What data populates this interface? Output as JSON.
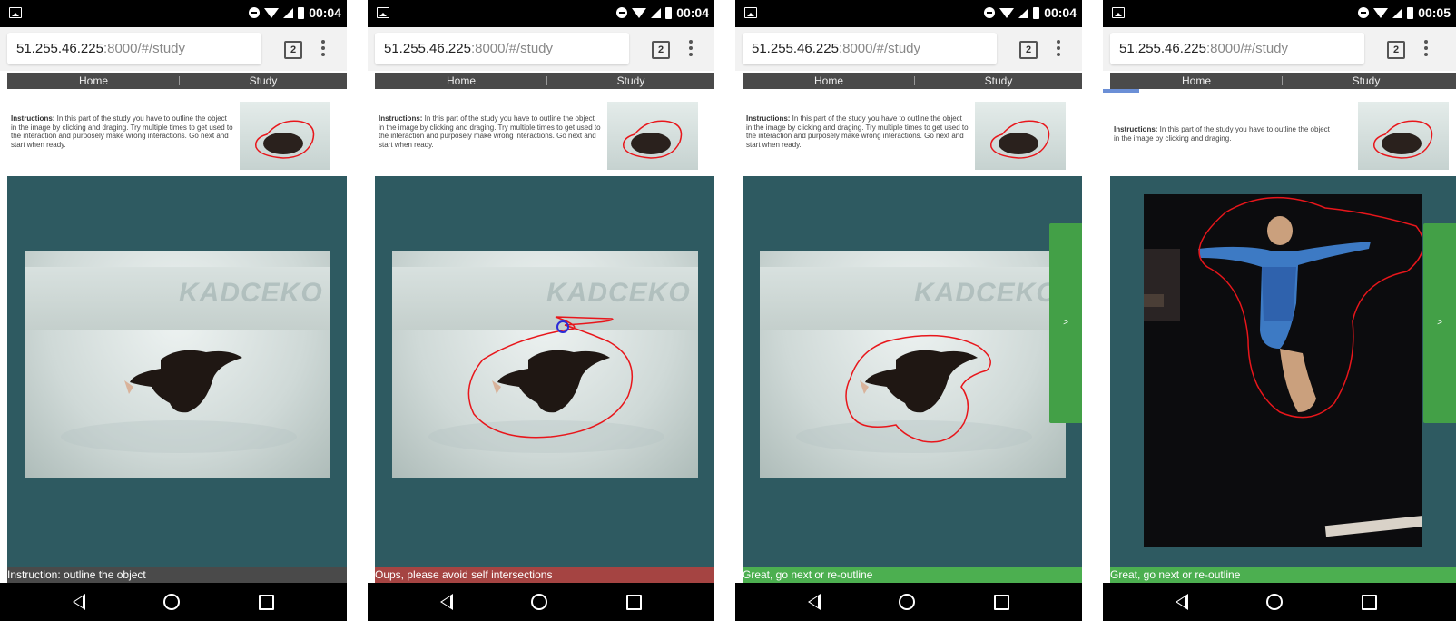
{
  "phones": [
    {
      "status_time": "00:04",
      "url_host": "51.255.46.225",
      "url_path": ":8000/#/study",
      "tab_count": "2",
      "nav": {
        "home": "Home",
        "study": "Study"
      },
      "instructions_label": "Instructions:",
      "instructions_text": " In this part of the study you have to outline the object in the image by clicking and draging. Try multiple times to get used to the interaction and purposely make wrong interactions. Go next and start when ready.",
      "message": "Instruction: outline the object",
      "message_status": "info",
      "photo_brand": "KADCEKO",
      "next_label": ""
    },
    {
      "status_time": "00:04",
      "url_host": "51.255.46.225",
      "url_path": ":8000/#/study",
      "tab_count": "2",
      "nav": {
        "home": "Home",
        "study": "Study"
      },
      "instructions_label": "Instructions:",
      "instructions_text": " In this part of the study you have to outline the object in the image by clicking and draging. Try multiple times to get used to the interaction and purposely make wrong interactions. Go next and start when ready.",
      "message": "Oups, please avoid self intersections",
      "message_status": "error",
      "photo_brand": "KADCEKO",
      "next_label": ""
    },
    {
      "status_time": "00:04",
      "url_host": "51.255.46.225",
      "url_path": ":8000/#/study",
      "tab_count": "2",
      "nav": {
        "home": "Home",
        "study": "Study"
      },
      "instructions_label": "Instructions:",
      "instructions_text": " In this part of the study you have to outline the object in the image by clicking and draging. Try multiple times to get used to the interaction and purposely make wrong interactions. Go next and start when ready.",
      "message": "Great, go next or re-outline",
      "message_status": "success",
      "photo_brand": "KADCEKO",
      "next_label": ">"
    },
    {
      "status_time": "00:05",
      "url_host": "51.255.46.225",
      "url_path": ":8000/#/study",
      "tab_count": "2",
      "nav": {
        "home": "Home",
        "study": "Study"
      },
      "instructions_label": "Instructions:",
      "instructions_text": " In this part of the study you have to outline the object in the image by clicking and draging.",
      "message": "Great, go next or re-outline",
      "message_status": "success",
      "photo_brand": "",
      "next_label": ">"
    }
  ],
  "colors": {
    "canvas_bg": "#2e5a61",
    "status_info": "#4a4a4a",
    "status_error": "#a54442",
    "status_success": "#4caf50",
    "outline": "#e8161b"
  }
}
